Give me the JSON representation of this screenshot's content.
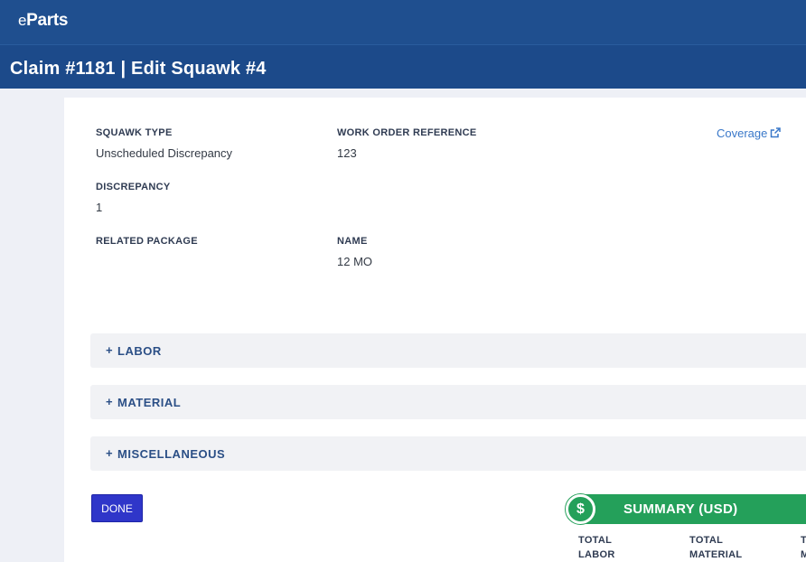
{
  "app": {
    "logo_prefix": "e",
    "logo_main": "Parts"
  },
  "page": {
    "title": "Claim #1181 | Edit Squawk #4"
  },
  "details": {
    "squawk_type": {
      "label": "SQUAWK TYPE",
      "value": "Unscheduled Discrepancy"
    },
    "work_order_reference": {
      "label": "WORK ORDER REFERENCE",
      "value": "123"
    },
    "discrepancy": {
      "label": "DISCREPANCY",
      "value": "1"
    },
    "related_package": {
      "label": "RELATED PACKAGE",
      "value": ""
    },
    "name": {
      "label": "NAME",
      "value": "12 MO"
    },
    "coverage_link": "Coverage"
  },
  "sections": [
    {
      "plus": "+",
      "label": "LABOR"
    },
    {
      "plus": "+",
      "label": "MATERIAL"
    },
    {
      "plus": "+",
      "label": "MISCELLANEOUS"
    }
  ],
  "actions": {
    "done_label": "DONE"
  },
  "summary": {
    "icon_glyph": "$",
    "title": "SUMMARY (USD)",
    "columns": [
      {
        "line1": "TOTAL",
        "line2": "LABOR"
      },
      {
        "line1": "TOTAL",
        "line2": "MATERIAL"
      },
      {
        "line1": "T",
        "line2": "M"
      }
    ]
  },
  "colors": {
    "header_blue": "#1f4f8f",
    "link_blue": "#3a78c9",
    "done_button": "#2f36c9",
    "summary_green": "#24a05a"
  },
  "icons": {
    "coverage": "external-link-icon",
    "summary": "dollar-icon"
  }
}
